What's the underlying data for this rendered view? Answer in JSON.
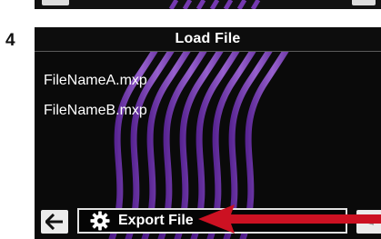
{
  "step_label": "4",
  "screen": {
    "title": "Load File",
    "files": [
      "FileNameA.mxp",
      "FileNameB.mxp"
    ],
    "export_label": "Export File",
    "back_icon": "arrow-left-icon",
    "export_icon": "gear-icon"
  },
  "colors": {
    "screen_bg": "#0a0a0a",
    "wave": "#8e44d8",
    "button_light": "#ebebeb",
    "arrow": "#cc1122"
  }
}
